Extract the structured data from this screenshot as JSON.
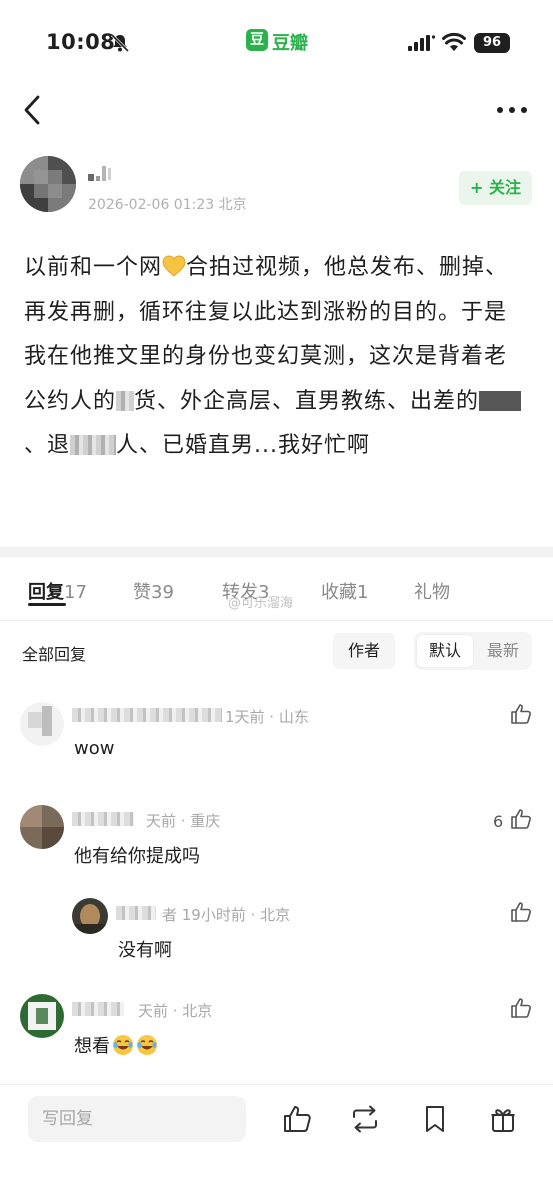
{
  "status_bar": {
    "time": "10:08",
    "app_badge": "豆",
    "app_name": "豆瓣",
    "battery": "96"
  },
  "post": {
    "date": "2026-02-06 01:23",
    "location": "北京",
    "follow_label": "+ 关注",
    "body": {
      "p1": "以前和一个网",
      "p2": "合拍过视频，他总发布、删掉、再发再删，循环往复以此达到涨粉的目的。于是我在他推文里的身份也变幻莫测，这次是背着老公约人的",
      "p3": "货、外企高层、直男教练、出差的",
      "p4": "、退",
      "p5": "人、已婚直男...我好忙啊"
    }
  },
  "tabs": [
    {
      "label": "回复",
      "count": "17"
    },
    {
      "label": "赞",
      "count": "39"
    },
    {
      "label": "转发",
      "count": "3"
    },
    {
      "label": "收藏",
      "count": "1"
    },
    {
      "label": "礼物",
      "count": ""
    }
  ],
  "watermark": "@可乐溜海",
  "filter": {
    "title": "全部回复",
    "author": "作者",
    "default": "默认",
    "latest": "最新"
  },
  "comments": [
    {
      "meta": "1天前 · 山东",
      "text": "wow",
      "likes": ""
    },
    {
      "meta": "天前 · 重庆",
      "text": "他有给你提成吗",
      "likes": "6"
    },
    {
      "meta": "者  19小时前 · 北京",
      "text": "没有啊",
      "likes": ""
    },
    {
      "meta": "天前 · 北京",
      "text": "想看",
      "likes": ""
    }
  ],
  "bottom_bar": {
    "reply_placeholder": "写回复"
  },
  "icons": [
    "mute-icon",
    "signal-icon",
    "wifi-icon",
    "back-icon",
    "more-icon",
    "heart-emoji",
    "thumbs-up-icon",
    "repost-icon",
    "bookmark-icon",
    "gift-icon",
    "laugh-cry-emoji"
  ],
  "colors": {
    "brand_green": "#2bb24c",
    "follow_bg": "#eaf6ec",
    "heart_yellow": "#f6c343"
  }
}
